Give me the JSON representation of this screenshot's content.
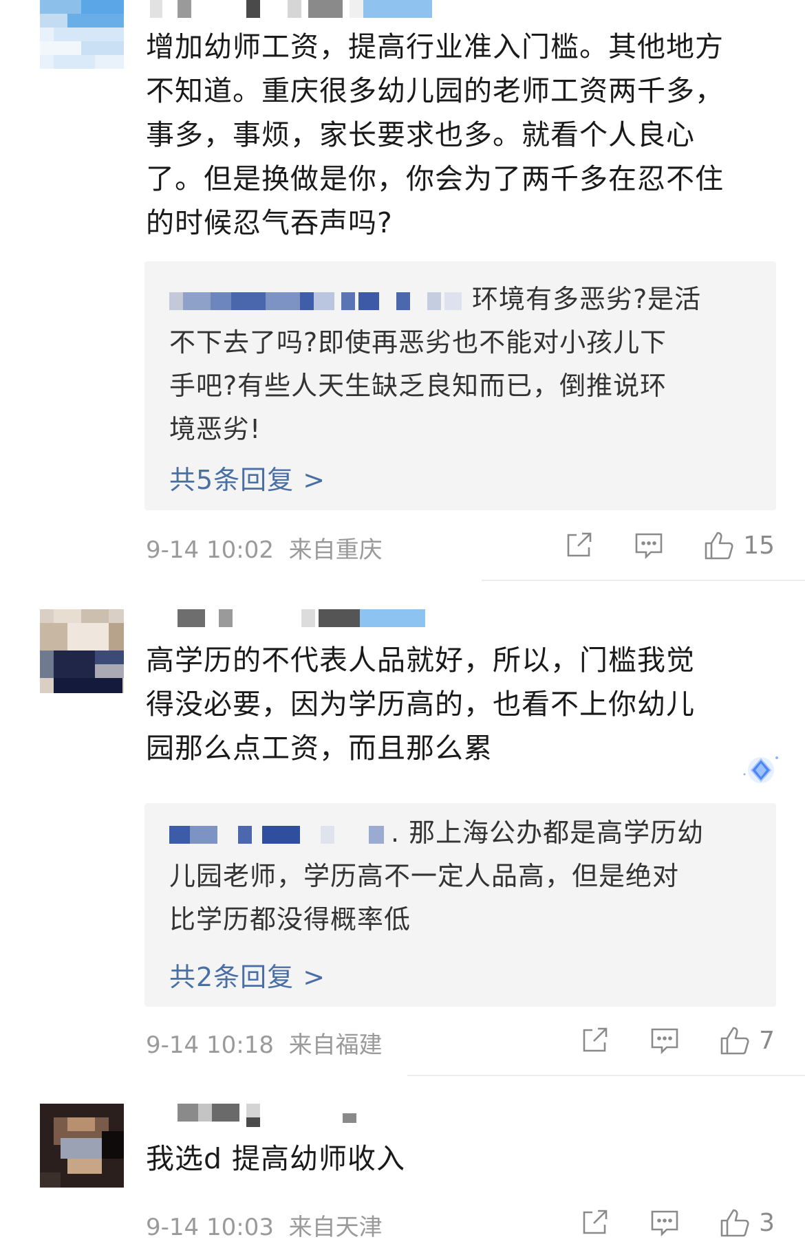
{
  "comments": [
    {
      "lines": [
        "增加幼师工资，提高行业准入门槛。其他地方",
        "不知道。重庆很多幼儿园的老师工资两千多，",
        "事多，事烦，家长要求也多。就看个人良心",
        "了。但是换做是你，你会为了两千多在忍不住",
        "的时候忍气吞声吗?"
      ],
      "reply_lines": [
        "环境有多恶劣?是活",
        "不下去了吗?即使再恶劣也不能对小孩儿下",
        "手吧?有些人天生缺乏良知而已，倒推说环",
        "境恶劣!"
      ],
      "more_replies": "共5条回复 >",
      "time": "9-14 10:02",
      "location": "来自重庆",
      "likes": "15"
    },
    {
      "lines": [
        "高学历的不代表人品就好，所以，门槛我觉",
        "得没必要，因为学历高的，也看不上你幼儿",
        "园那么点工资，而且那么累"
      ],
      "reply_lines": [
        ". 那上海公办都是高学历幼",
        "儿园老师，学历高不一定人品高，但是绝对",
        "比学历都没得概率低"
      ],
      "more_replies": "共2条回复 >",
      "time": "9-14 10:18",
      "location": "来自福建",
      "likes": "7"
    },
    {
      "lines": [
        "我选d 提高幼师收入"
      ],
      "time": "9-14 10:03",
      "location": "来自天津",
      "likes": "3"
    }
  ],
  "icons": {
    "share": "share-icon",
    "comment": "comment-icon",
    "like": "thumbs-up-icon",
    "badge": "diamond-badge-icon"
  },
  "colors": {
    "link": "#4a6fa5",
    "meta": "#9a9a9a",
    "reply_bg": "#f4f4f4"
  }
}
